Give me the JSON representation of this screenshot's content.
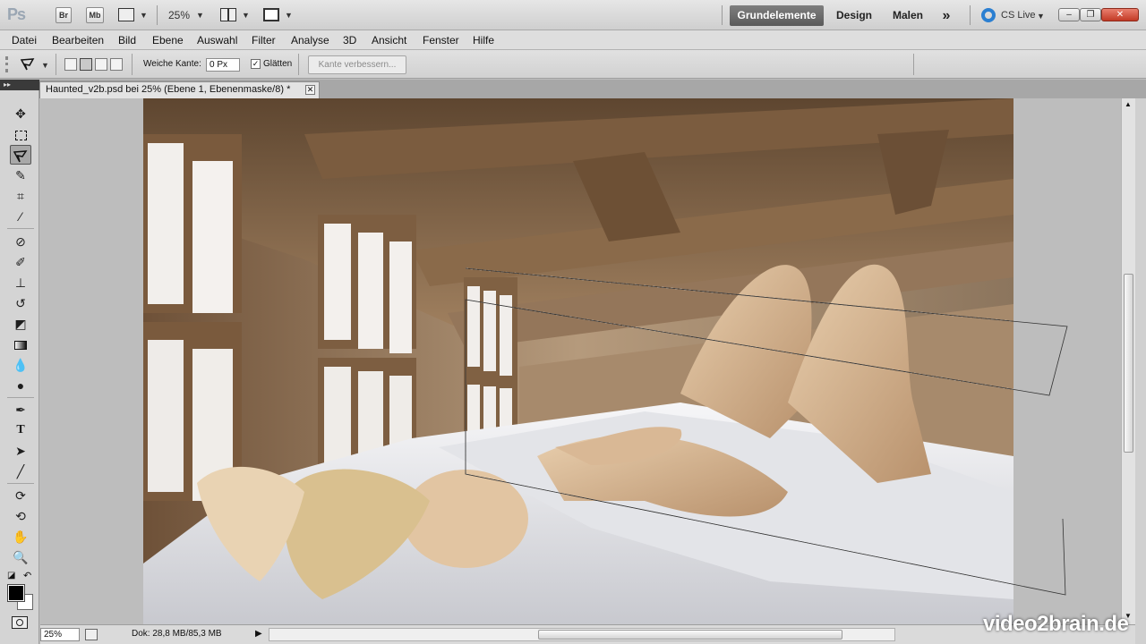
{
  "app": {
    "logo": "Ps",
    "bridge": "Br",
    "minibridge": "Mb",
    "zoom": "25%",
    "workspaces": [
      "Grundelemente",
      "Design",
      "Malen"
    ],
    "more": "»",
    "cslive": "CS Live"
  },
  "menu": [
    "Datei",
    "Bearbeiten",
    "Bild",
    "Ebene",
    "Auswahl",
    "Filter",
    "Analyse",
    "3D",
    "Ansicht",
    "Fenster",
    "Hilfe"
  ],
  "options": {
    "feather_label": "Weiche Kante:",
    "feather_value": "0 Px",
    "antialias_label": "Glätten",
    "refine_label": "Kante verbessern..."
  },
  "document": {
    "tab_title": "Haunted_v2b.psd bei 25% (Ebene 1, Ebenenmaske/8) *"
  },
  "status": {
    "zoom": "25%",
    "doc_info": "Dok: 28,8 MB/85,3 MB"
  },
  "watermark": "video2brain.de",
  "icons": {
    "move": "move-icon",
    "marquee": "rect-marquee-icon",
    "lasso": "polygonal-lasso-icon",
    "quick_select": "quick-selection-icon",
    "crop": "crop-icon",
    "eyedropper": "eyedropper-icon",
    "healing": "healing-brush-icon",
    "brush": "brush-icon",
    "stamp": "clone-stamp-icon",
    "history": "history-brush-icon",
    "eraser": "eraser-icon",
    "gradient": "gradient-icon",
    "blur": "blur-icon",
    "dodge": "dodge-icon",
    "pen": "pen-icon",
    "type": "type-icon",
    "path_select": "path-selection-icon",
    "line": "line-icon",
    "3d_rotate": "3d-rotate-icon",
    "3d_orbit": "3d-orbit-icon",
    "hand": "hand-icon",
    "zoom": "zoom-icon"
  }
}
